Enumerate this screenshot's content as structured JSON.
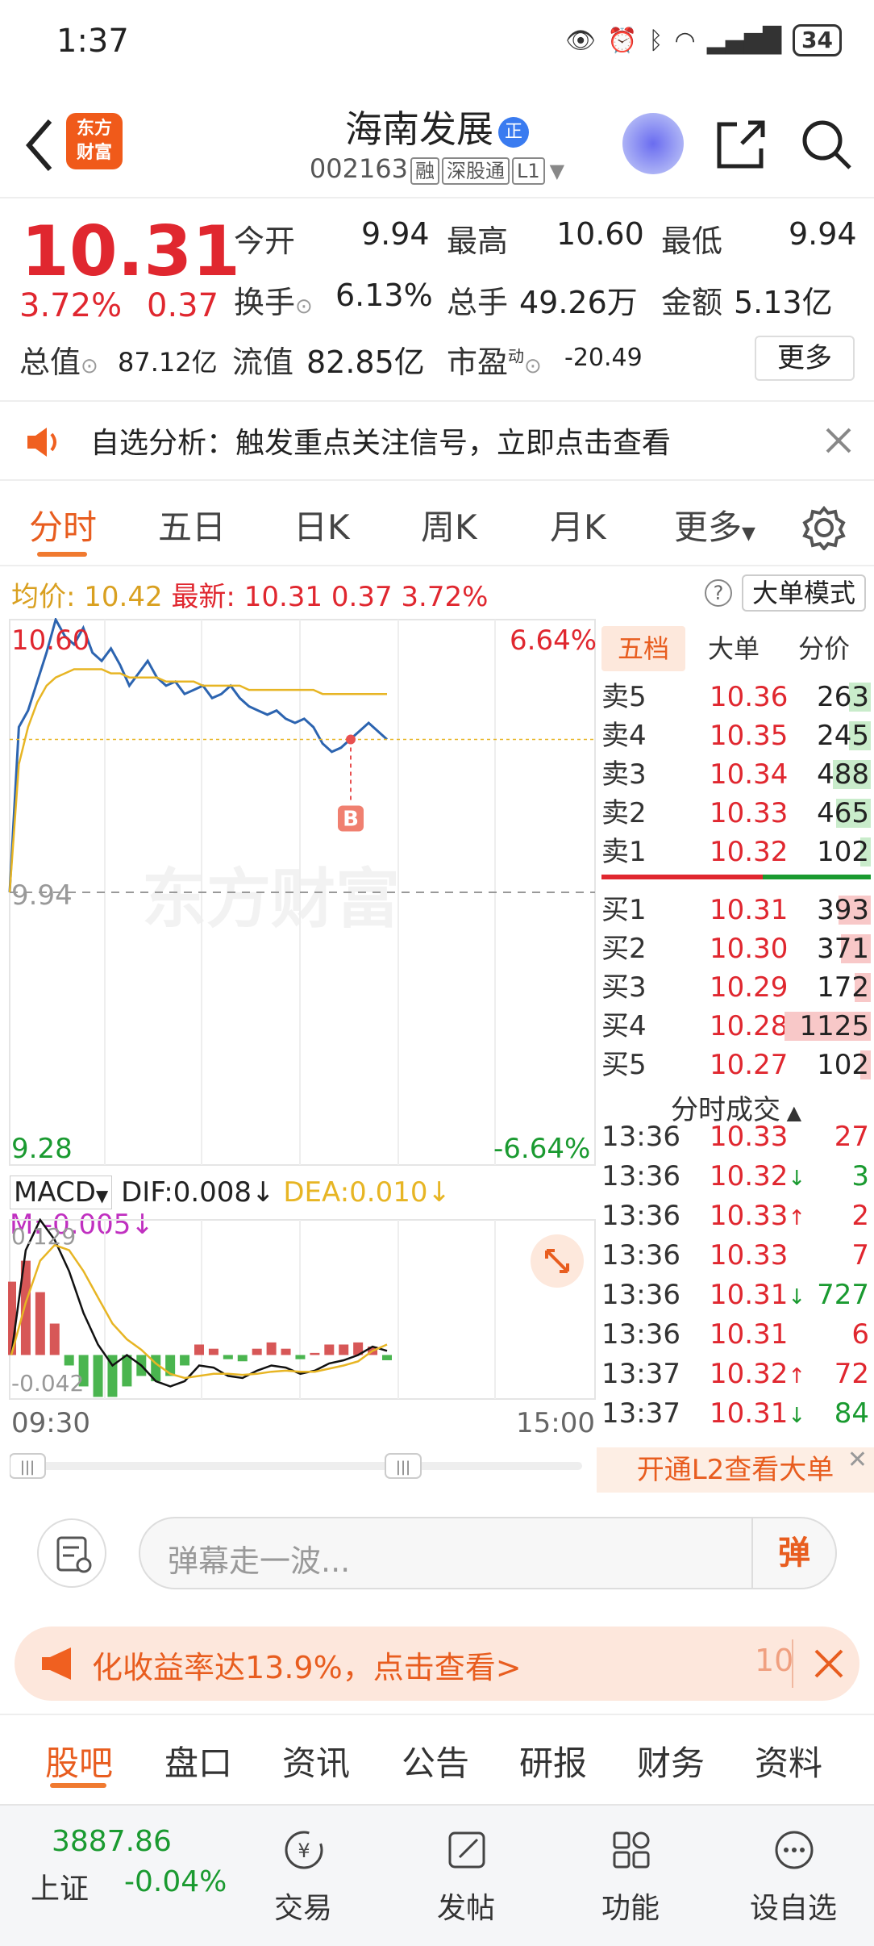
{
  "status_bar": {
    "time": "1:37",
    "battery": "34"
  },
  "header": {
    "title": "海南发展",
    "title_badge": "正",
    "code": "002163",
    "tags": [
      "融",
      "深股通",
      "L1"
    ],
    "logo_text": "东方\n财富"
  },
  "quote": {
    "price": "10.31",
    "pct": "3.72%",
    "change": "0.37",
    "rows": [
      [
        {
          "label": "今开",
          "value": "9.94",
          "color": "#222"
        },
        {
          "label": "最高",
          "value": "10.60",
          "color": "#e0272f"
        },
        {
          "label": "最低",
          "value": "9.94",
          "color": "#222"
        }
      ],
      [
        {
          "label": "换手",
          "value": "6.13%",
          "color": "#222"
        },
        {
          "label": "总手",
          "value": "49.26万",
          "color": "#222"
        },
        {
          "label": "金额",
          "value": "5.13亿",
          "color": "#222"
        }
      ]
    ],
    "total_value_label": "总值",
    "total_value": "87.12亿",
    "float_value_label": "流值",
    "float_value": "82.85亿",
    "pe_label": "市盈",
    "pe_sup": "动",
    "pe_value": "-20.49",
    "more_label": "更多"
  },
  "analysis_banner": {
    "text": "自选分析：触发重点关注信号，立即点击查看"
  },
  "chart_tabs": [
    "分时",
    "五日",
    "日K",
    "周K",
    "月K",
    "更多"
  ],
  "chart_info": {
    "avg_label": "均价:",
    "avg_value": "10.42",
    "latest_label": "最新:",
    "latest_value": "10.31",
    "latest_change": "0.37",
    "latest_pct": "3.72%",
    "mode_button": "大单模式"
  },
  "chart_data": {
    "type": "line",
    "title": "",
    "price_axis": {
      "top": "10.60",
      "mid": "9.94",
      "bottom": "9.28"
    },
    "pct_axis": {
      "top": "6.64%",
      "bottom": "-6.64%"
    },
    "ylim": [
      9.28,
      10.6
    ],
    "prev_close": 9.94,
    "time_axis": {
      "start": "09:30",
      "end": "15:00"
    },
    "series": [
      {
        "name": "",
        "color": "#2c64b0",
        "values": [
          9.94,
          10.34,
          10.38,
          10.45,
          10.52,
          10.6,
          10.56,
          10.54,
          10.58,
          10.52,
          10.5,
          10.53,
          10.49,
          10.44,
          10.47,
          10.5,
          10.46,
          10.44,
          10.45,
          10.42,
          10.43,
          10.44,
          10.41,
          10.42,
          10.44,
          10.41,
          10.39,
          10.38,
          10.37,
          10.38,
          10.36,
          10.35,
          10.36,
          10.34,
          10.3,
          10.28,
          10.29,
          10.31,
          10.33,
          10.35,
          10.33,
          10.31
        ]
      },
      {
        "name": "",
        "color": "#e7b524",
        "values": [
          9.94,
          10.25,
          10.34,
          10.4,
          10.44,
          10.46,
          10.47,
          10.48,
          10.48,
          10.48,
          10.48,
          10.47,
          10.47,
          10.46,
          10.46,
          10.46,
          10.46,
          10.45,
          10.45,
          10.45,
          10.45,
          10.44,
          10.44,
          10.44,
          10.44,
          10.44,
          10.43,
          10.43,
          10.43,
          10.43,
          10.43,
          10.43,
          10.43,
          10.43,
          10.42,
          10.42,
          10.42,
          10.42,
          10.42,
          10.42,
          10.42,
          10.42
        ]
      }
    ],
    "marker": {
      "label": "B",
      "value": 10.31
    },
    "watermark": "东方财富"
  },
  "macd": {
    "indicator": "MACD",
    "dif_label": "DIF:",
    "dif": "0.008",
    "dea_label": "DEA:",
    "dea": "0.010",
    "m_label": "M:",
    "m": "-0.005",
    "top": "0.129",
    "bottom": "-0.042",
    "ylim": [
      -0.042,
      0.129
    ],
    "dif_values": [
      0.0,
      0.1,
      0.129,
      0.11,
      0.08,
      0.04,
      0.01,
      -0.01,
      0.0,
      -0.01,
      -0.025,
      -0.03,
      -0.025,
      -0.01,
      -0.012,
      -0.02,
      -0.022,
      -0.015,
      -0.01,
      -0.012,
      -0.018,
      -0.015,
      -0.008,
      -0.005,
      0.0,
      0.008,
      0.004
    ],
    "dea_values": [
      0.0,
      0.05,
      0.09,
      0.105,
      0.1,
      0.08,
      0.055,
      0.03,
      0.015,
      0.005,
      -0.008,
      -0.018,
      -0.022,
      -0.02,
      -0.018,
      -0.018,
      -0.019,
      -0.018,
      -0.016,
      -0.015,
      -0.016,
      -0.016,
      -0.013,
      -0.01,
      -0.006,
      0.004,
      0.01
    ],
    "hist_values": [
      0.07,
      0.09,
      0.06,
      0.03,
      -0.01,
      -0.03,
      -0.04,
      -0.04,
      -0.03,
      -0.02,
      -0.025,
      -0.02,
      -0.01,
      0.01,
      0.006,
      -0.004,
      -0.006,
      0.006,
      0.012,
      0.006,
      -0.004,
      0.002,
      0.01,
      0.01,
      0.012,
      0.008,
      -0.005
    ]
  },
  "order_book": {
    "tabs": [
      "五档",
      "大单",
      "分价"
    ],
    "asks": [
      {
        "label": "卖5",
        "price": "10.36",
        "vol": "263",
        "bar": 0.08
      },
      {
        "label": "卖4",
        "price": "10.35",
        "vol": "245",
        "bar": 0.08
      },
      {
        "label": "卖3",
        "price": "10.34",
        "vol": "488",
        "bar": 0.14
      },
      {
        "label": "卖2",
        "price": "10.33",
        "vol": "465",
        "bar": 0.13
      },
      {
        "label": "卖1",
        "price": "10.32",
        "vol": "102",
        "bar": 0.04
      }
    ],
    "bids": [
      {
        "label": "买1",
        "price": "10.31",
        "vol": "393",
        "bar": 0.12
      },
      {
        "label": "买2",
        "price": "10.30",
        "vol": "371",
        "bar": 0.11
      },
      {
        "label": "买3",
        "price": "10.29",
        "vol": "172",
        "bar": 0.06
      },
      {
        "label": "买4",
        "price": "10.28",
        "vol": "1125",
        "bar": 0.32
      },
      {
        "label": "买5",
        "price": "10.27",
        "vol": "102",
        "bar": 0.04
      }
    ]
  },
  "ticks": {
    "title": "分时成交",
    "rows": [
      {
        "time": "13:36",
        "price": "10.33",
        "arrow": "",
        "vol": "27",
        "pc": "#e0272f",
        "vc": "#e0272f"
      },
      {
        "time": "13:36",
        "price": "10.32",
        "arrow": "↓",
        "vol": "3",
        "pc": "#e0272f",
        "vc": "#1a9a30"
      },
      {
        "time": "13:36",
        "price": "10.33",
        "arrow": "↑",
        "vol": "2",
        "pc": "#e0272f",
        "vc": "#e0272f"
      },
      {
        "time": "13:36",
        "price": "10.33",
        "arrow": "",
        "vol": "7",
        "pc": "#e0272f",
        "vc": "#e0272f"
      },
      {
        "time": "13:36",
        "price": "10.31",
        "arrow": "↓",
        "vol": "727",
        "pc": "#e0272f",
        "vc": "#1a9a30"
      },
      {
        "time": "13:36",
        "price": "10.31",
        "arrow": "",
        "vol": "6",
        "pc": "#e0272f",
        "vc": "#e0272f"
      },
      {
        "time": "13:37",
        "price": "10.32",
        "arrow": "↑",
        "vol": "72",
        "pc": "#e0272f",
        "vc": "#e0272f"
      },
      {
        "time": "13:37",
        "price": "10.31",
        "arrow": "↓",
        "vol": "84",
        "pc": "#e0272f",
        "vc": "#1a9a30"
      }
    ],
    "l2_text": "开通L2查看大单"
  },
  "danmu": {
    "placeholder": "弹幕走一波...",
    "send": "弹"
  },
  "promo": {
    "text": "化收益率达13.9%，点击查看>",
    "count": "10"
  },
  "sub_nav": [
    "股吧",
    "盘口",
    "资讯",
    "公告",
    "研报",
    "财务",
    "资料"
  ],
  "bottom_nav": {
    "index_value": "3887.86",
    "index_name": "上证",
    "index_change": "-0.04%",
    "items": [
      "交易",
      "发帖",
      "功能",
      "设自选"
    ]
  },
  "colors": {
    "accent": "#e85d1f",
    "up": "#e0272f",
    "down": "#1a9a30",
    "price_line": "#2c64b0",
    "avg_line": "#e7b524"
  }
}
